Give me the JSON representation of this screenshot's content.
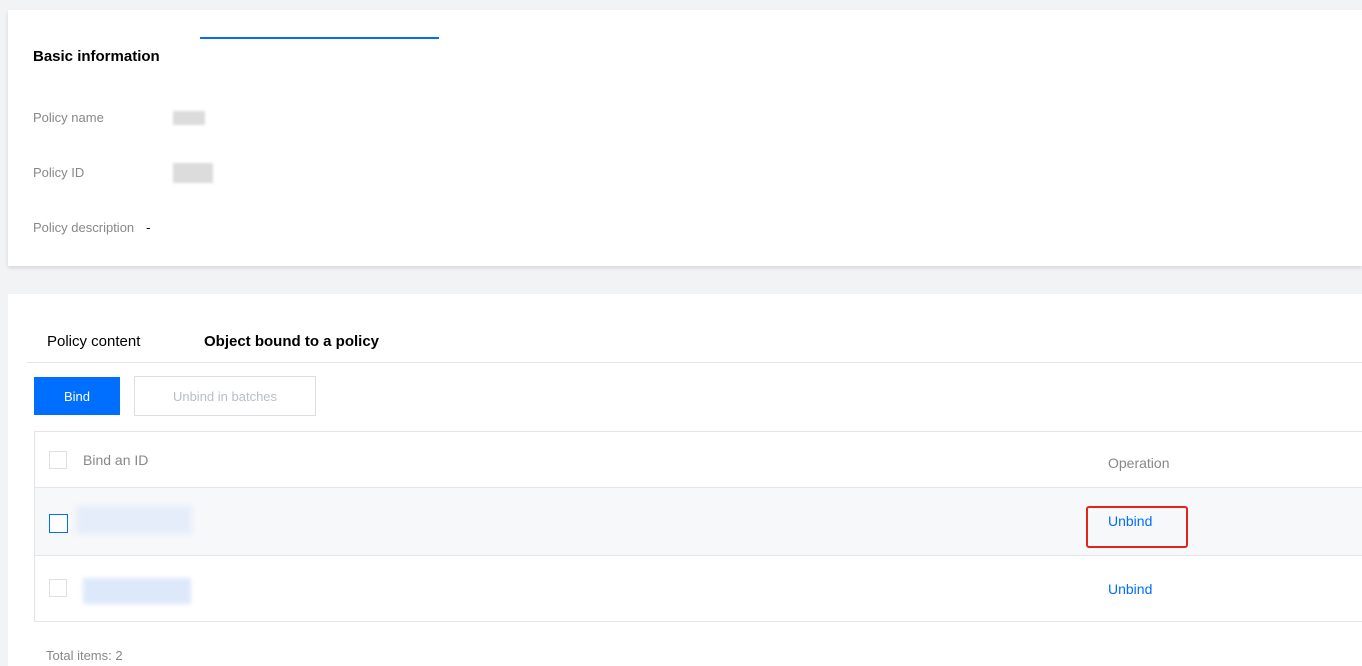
{
  "basic_info": {
    "title": "Basic information",
    "fields": [
      {
        "label": "Policy name",
        "value": ""
      },
      {
        "label": "Policy ID",
        "value": ""
      },
      {
        "label": "Policy description",
        "value": "-"
      }
    ]
  },
  "tabs": [
    {
      "label": "Policy content",
      "active": false
    },
    {
      "label": "Object bound to a policy",
      "active": true
    }
  ],
  "toolbar": {
    "bind_label": "Bind",
    "unbind_batches_label": "Unbind in batches"
  },
  "table": {
    "columns": [
      "Bind an ID",
      "Operation"
    ],
    "rows": [
      {
        "bind_id": "",
        "operation": "Unbind",
        "highlighted": true
      },
      {
        "bind_id": "",
        "operation": "Unbind",
        "highlighted": false
      }
    ]
  },
  "footer": {
    "total_items": "Total items: 2"
  },
  "colors": {
    "accent": "#006eff",
    "highlight": "#e1251b",
    "background": "#f2f3f5"
  }
}
